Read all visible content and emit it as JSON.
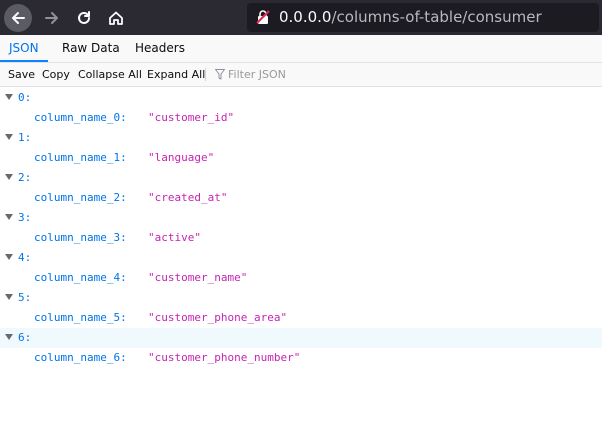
{
  "browser": {
    "url_host": "0.0.0.0",
    "url_path": "/columns-of-table/consumer"
  },
  "tabs": [
    {
      "label": "JSON",
      "active": true
    },
    {
      "label": "Raw Data",
      "active": false
    },
    {
      "label": "Headers",
      "active": false
    }
  ],
  "toolbar": {
    "save": "Save",
    "copy": "Copy",
    "collapse_all": "Collapse All",
    "expand_all": "Expand All",
    "filter_placeholder": "Filter JSON"
  },
  "colors": {
    "key": "#0074e8",
    "string": "#c724b1",
    "active_tab": "#0a84ff"
  },
  "rows": [
    {
      "index": "0:",
      "key": "column_name_0:",
      "value": "\"customer_id\""
    },
    {
      "index": "1:",
      "key": "column_name_1:",
      "value": "\"language\""
    },
    {
      "index": "2:",
      "key": "column_name_2:",
      "value": "\"created_at\""
    },
    {
      "index": "3:",
      "key": "column_name_3:",
      "value": "\"active\""
    },
    {
      "index": "4:",
      "key": "column_name_4:",
      "value": "\"customer_name\""
    },
    {
      "index": "5:",
      "key": "column_name_5:",
      "value": "\"customer_phone_area\""
    },
    {
      "index": "6:",
      "key": "column_name_6:",
      "value": "\"customer_phone_number\"",
      "highlighted": true
    }
  ]
}
